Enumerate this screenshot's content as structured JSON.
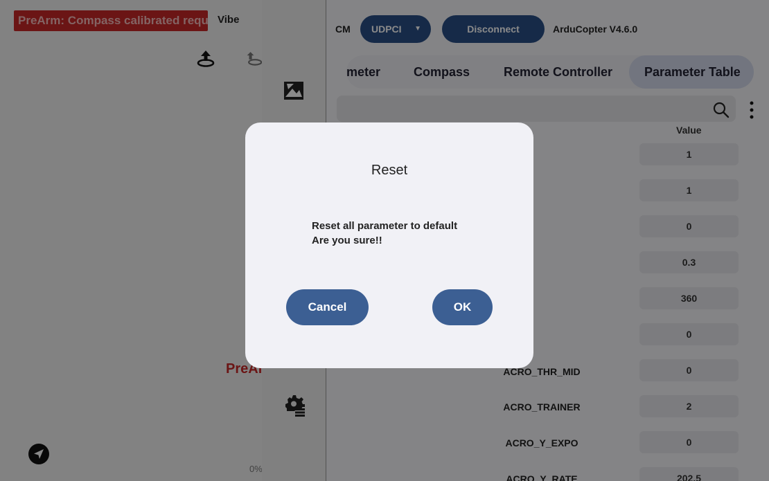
{
  "left": {
    "alert_text": "PreArm: Compass calibrated requ",
    "vibe_label": "Vibe",
    "prearm_fragment": "PreAr",
    "percent_fragment": "0%"
  },
  "connection": {
    "cm_label": "CM",
    "protocol": "UDPCI",
    "disconnect_label": "Disconnect",
    "firmware": "ArduCopter V4.6.0"
  },
  "tabs": [
    {
      "label": "meter",
      "active": false
    },
    {
      "label": "Compass",
      "active": false
    },
    {
      "label": "Remote Controller",
      "active": false
    },
    {
      "label": "Parameter Table",
      "active": true
    }
  ],
  "search": {
    "placeholder": ""
  },
  "table": {
    "value_header": "Value",
    "rows": [
      {
        "name": "",
        "value": "1"
      },
      {
        "name": "",
        "value": "1"
      },
      {
        "name": "",
        "value": "0"
      },
      {
        "name": "",
        "value": "0.3"
      },
      {
        "name": "",
        "value": "360"
      },
      {
        "name": "",
        "value": "0"
      },
      {
        "name": "ACRO_THR_MID",
        "value": "0"
      },
      {
        "name": "ACRO_TRAINER",
        "value": "2"
      },
      {
        "name": "ACRO_Y_EXPO",
        "value": "0"
      },
      {
        "name": "ACRO_Y_RATE",
        "value": "202.5"
      }
    ]
  },
  "dialog": {
    "title": "Reset",
    "message_line1": "Reset all parameter to default",
    "message_line2": "Are you sure!!",
    "cancel_label": "Cancel",
    "ok_label": "OK"
  },
  "colors": {
    "alert_red": "#c62828",
    "primary_blue": "#2a4f86",
    "dialog_button_blue": "#3c5f93",
    "active_tab": "#d2d8ea"
  },
  "icons": {
    "upload": "upload-icon",
    "rotate": "rotate-icon",
    "dashboard": "dashboard-icon",
    "settings": "settings-gear-icon",
    "send": "send-icon",
    "search": "search-icon",
    "more": "more-vertical-icon"
  }
}
